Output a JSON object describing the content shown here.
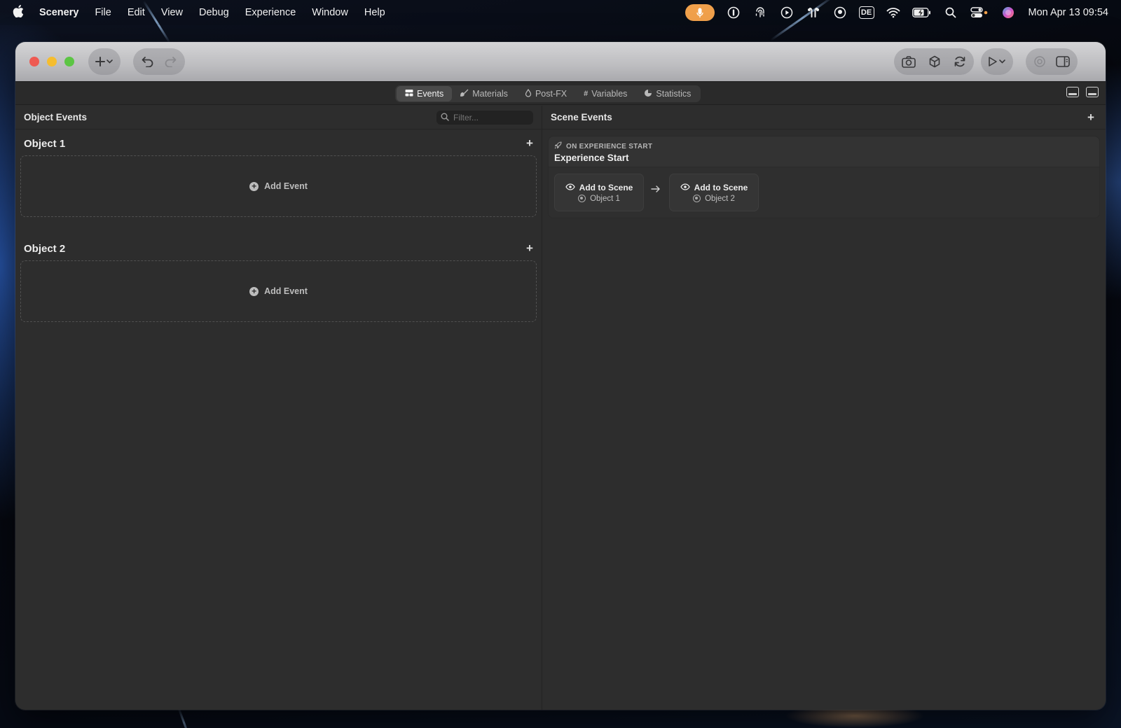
{
  "menubar": {
    "app_name": "Scenery",
    "items": [
      "File",
      "Edit",
      "View",
      "Debug",
      "Experience",
      "Window",
      "Help"
    ],
    "keyboard_layout": "DE",
    "clock": "Mon Apr 13  09:54"
  },
  "tabs": [
    {
      "label": "Events",
      "icon": "events-icon",
      "active": true
    },
    {
      "label": "Materials",
      "icon": "brush-icon",
      "active": false
    },
    {
      "label": "Post-FX",
      "icon": "drop-icon",
      "active": false
    },
    {
      "label": "Variables",
      "icon": "hash-icon",
      "active": false
    },
    {
      "label": "Statistics",
      "icon": "chart-pie-icon",
      "active": false
    }
  ],
  "left_pane": {
    "title": "Object Events",
    "filter_placeholder": "Filter...",
    "objects": [
      {
        "name": "Object 1",
        "add_event_label": "Add Event"
      },
      {
        "name": "Object 2",
        "add_event_label": "Add Event"
      }
    ]
  },
  "right_pane": {
    "title": "Scene Events",
    "event": {
      "trigger_type": "ON EXPERIENCE START",
      "trigger_title": "Experience Start",
      "actions": [
        {
          "title": "Add to Scene",
          "target": "Object 1"
        },
        {
          "title": "Add to Scene",
          "target": "Object 2"
        }
      ]
    }
  },
  "colors": {
    "mic_accent": "#f0a04b",
    "window_bg": "#2d2d2d",
    "close": "#ee5a52",
    "minimize": "#f5bd2f",
    "maximize": "#5cc544"
  }
}
